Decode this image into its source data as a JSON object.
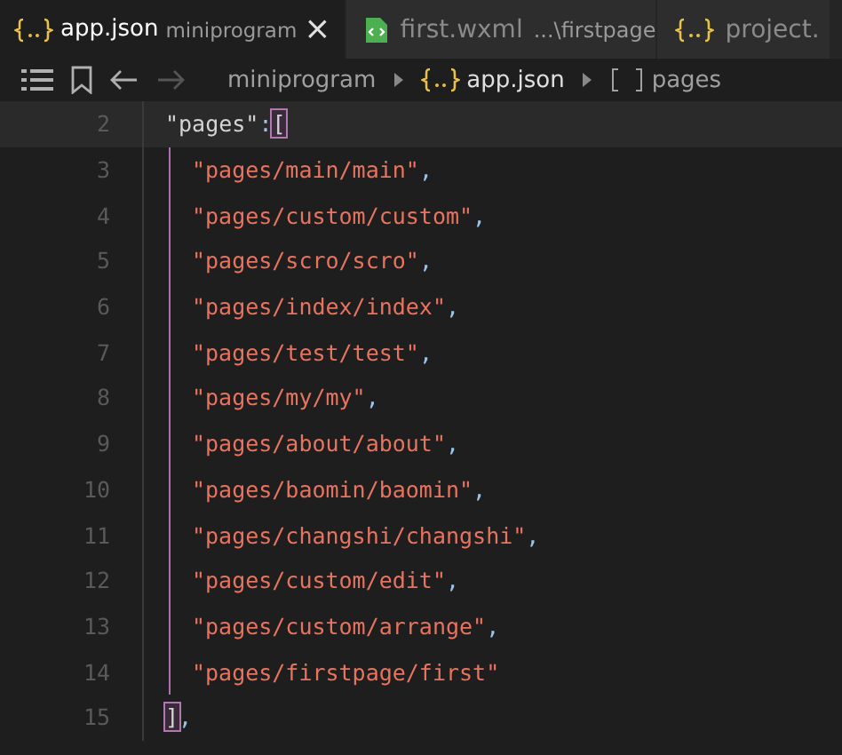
{
  "tabs": [
    {
      "kind": "json",
      "label": "app.json",
      "detail": "miniprogram",
      "close": "×",
      "selected": true
    },
    {
      "kind": "wxml",
      "label": "first.wxml",
      "detail": "...\\firstpage",
      "selected": false
    },
    {
      "kind": "json",
      "label": "project.",
      "selected": false
    }
  ],
  "breadcrumb": [
    {
      "kind": "folder",
      "label": "miniprogram"
    },
    {
      "kind": "json",
      "label": "app.json"
    },
    {
      "kind": "array",
      "label": "pages"
    }
  ],
  "lines": [
    {
      "number": "2",
      "current": true,
      "tokens": [
        {
          "kind": "key",
          "text": "\"pages\""
        },
        {
          "kind": "punct",
          "text": ":"
        },
        {
          "kind": "bracket",
          "text": "["
        }
      ],
      "children": [
        {
          "number": "3",
          "current": false,
          "tokens": [
            {
              "kind": "string",
              "text": "\"pages/main/main\""
            },
            {
              "kind": "punct",
              "text": ","
            }
          ]
        },
        {
          "number": "4",
          "current": false,
          "tokens": [
            {
              "kind": "string",
              "text": "\"pages/custom/custom\""
            },
            {
              "kind": "punct",
              "text": ","
            }
          ]
        },
        {
          "number": "5",
          "current": false,
          "tokens": [
            {
              "kind": "string",
              "text": "\"pages/scro/scro\""
            },
            {
              "kind": "punct",
              "text": ","
            }
          ]
        },
        {
          "number": "6",
          "current": false,
          "tokens": [
            {
              "kind": "string",
              "text": "\"pages/index/index\""
            },
            {
              "kind": "punct",
              "text": ","
            }
          ]
        },
        {
          "number": "7",
          "current": false,
          "tokens": [
            {
              "kind": "string",
              "text": "\"pages/test/test\""
            },
            {
              "kind": "punct",
              "text": ","
            }
          ]
        },
        {
          "number": "8",
          "current": false,
          "tokens": [
            {
              "kind": "string",
              "text": "\"pages/my/my\""
            },
            {
              "kind": "punct",
              "text": ","
            }
          ]
        },
        {
          "number": "9",
          "current": false,
          "tokens": [
            {
              "kind": "string",
              "text": "\"pages/about/about\""
            },
            {
              "kind": "punct",
              "text": ","
            }
          ]
        },
        {
          "number": "10",
          "current": false,
          "tokens": [
            {
              "kind": "string",
              "text": "\"pages/baomin/baomin\""
            },
            {
              "kind": "punct",
              "text": ","
            }
          ]
        },
        {
          "number": "11",
          "current": false,
          "tokens": [
            {
              "kind": "string",
              "text": "\"pages/changshi/changshi\""
            },
            {
              "kind": "punct",
              "text": ","
            }
          ]
        },
        {
          "number": "12",
          "current": false,
          "tokens": [
            {
              "kind": "string",
              "text": "\"pages/custom/edit\""
            },
            {
              "kind": "punct",
              "text": ","
            }
          ]
        },
        {
          "number": "13",
          "current": false,
          "tokens": [
            {
              "kind": "string",
              "text": "\"pages/custom/arrange\""
            },
            {
              "kind": "punct",
              "text": ","
            }
          ]
        },
        {
          "number": "14",
          "current": false,
          "tokens": [
            {
              "kind": "string",
              "text": "\"pages/firstpage/first\""
            }
          ]
        }
      ]
    },
    {
      "number": "15",
      "current": false,
      "tokens": [
        {
          "kind": "bracket",
          "text": "]"
        },
        {
          "kind": "punct",
          "text": ","
        }
      ]
    }
  ]
}
